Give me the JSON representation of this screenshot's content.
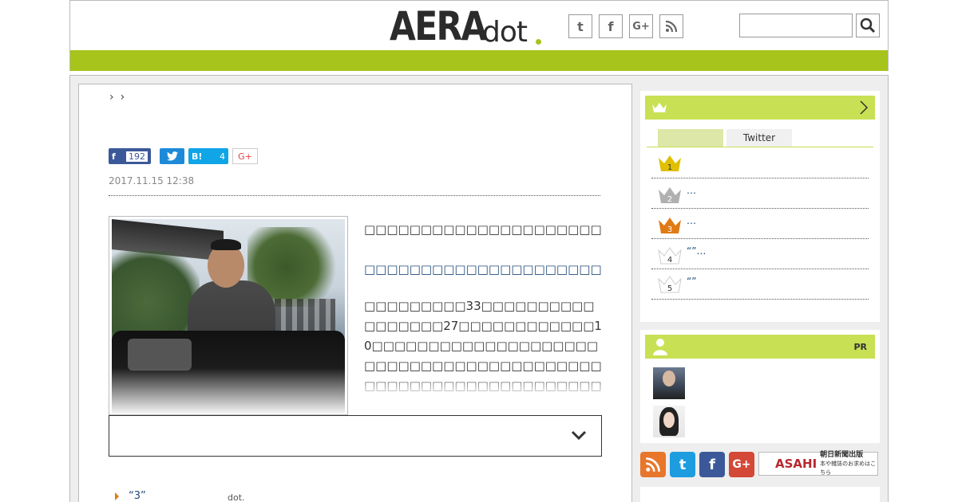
{
  "header": {
    "logo_main": "AERA",
    "logo_sub": "dot",
    "social": [
      {
        "name": "twitter-icon",
        "glyph": "t"
      },
      {
        "name": "facebook-icon",
        "glyph": "f"
      },
      {
        "name": "googleplus-icon",
        "glyph": "G+"
      },
      {
        "name": "rss-icon",
        "glyph": ""
      }
    ],
    "search_placeholder": "",
    "accent_color": "#a6c41c"
  },
  "breadcrumb": [
    "›",
    "›"
  ],
  "share": {
    "facebook_count": "192",
    "hatena_label": "B!",
    "hatena_count": "4",
    "googleplus_label": "G+"
  },
  "article": {
    "date": "2017.11.15 12:38",
    "lead": "□□□□□□□□□□□□□□□□□□□□□□□□□□",
    "subhead": "□□□□□□□□□□□□□□□□□□□□□□□",
    "body": "□□□□□□□□□33□□□□□□□□□□□□□□□□□27□□□□□□□□□□□□10□□□□□□□□□□□□□□□□□□□□□□□□□□□□□□□□□□□□□□□□□□□□□□□□□□□□□□□□□□□□□□□□□□□□□□□□□□□□□□□□□□□□□□□□□□□□□□□□□□□□"
  },
  "related": {
    "title": "“3”",
    "source": "dot."
  },
  "ranking": {
    "tabs": [
      "",
      "Twitter"
    ],
    "items": [
      {
        "rank": "1",
        "text": "",
        "color": "#e0c000"
      },
      {
        "rank": "2",
        "text": "…",
        "color": "#b0b0b0"
      },
      {
        "rank": "3",
        "text": "…",
        "color": "#e07b14"
      },
      {
        "rank": "4",
        "text": "“”…",
        "color": "#ffffff"
      },
      {
        "rank": "5",
        "text": "“”",
        "color": "#ffffff"
      }
    ]
  },
  "pr": {
    "label": "PR"
  },
  "footer_links": {
    "asahi_logo": "ASAHI",
    "asahi_line1": "朝日新聞出版",
    "asahi_line2": "本や雑誌のお求めはこちら"
  }
}
